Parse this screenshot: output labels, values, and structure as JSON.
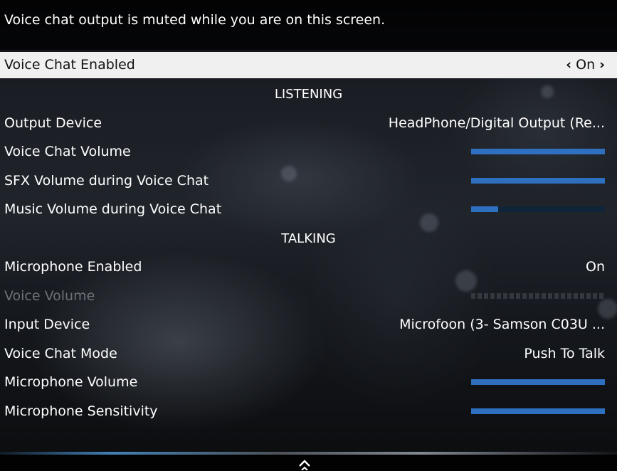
{
  "top_message": "Voice chat output is muted while you are on this screen.",
  "voice_chat_enabled": {
    "label": "Voice Chat Enabled",
    "value": "On"
  },
  "listening": {
    "header": "LISTENING",
    "output_device": {
      "label": "Output Device",
      "value": "HeadPhone/Digital Output (Re..."
    },
    "voice_chat_volume": {
      "label": "Voice Chat Volume",
      "level": 1.0
    },
    "sfx_volume": {
      "label": "SFX Volume during Voice Chat",
      "level": 1.0
    },
    "music_volume": {
      "label": "Music Volume during Voice Chat",
      "level": 0.2
    }
  },
  "talking": {
    "header": "TALKING",
    "microphone_enabled": {
      "label": "Microphone Enabled",
      "value": "On"
    },
    "voice_volume": {
      "label": "Voice Volume",
      "disabled": true
    },
    "input_device": {
      "label": "Input Device",
      "value": "Microfoon (3- Samson C03U  ..."
    },
    "voice_chat_mode": {
      "label": "Voice Chat Mode",
      "value": "Push To Talk"
    },
    "microphone_volume": {
      "label": "Microphone Volume",
      "level": 1.0
    },
    "microphone_sensitivity": {
      "label": "Microphone Sensitivity",
      "level": 1.0
    }
  },
  "colors": {
    "bar_fill": "#2f6fbf",
    "bar_track": "#0f2438",
    "selected_row": "#f0f0f0"
  },
  "icons": {
    "prev": "chevron-left-icon",
    "next": "chevron-right-icon",
    "scroll": "chevron-up-icon"
  }
}
